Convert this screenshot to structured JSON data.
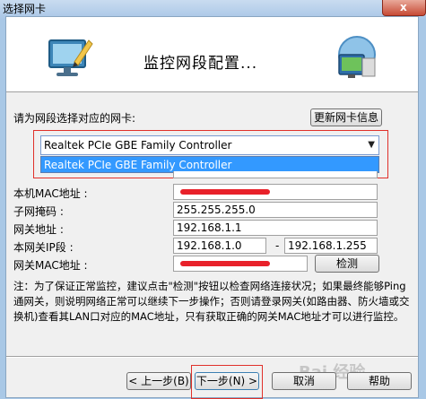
{
  "window": {
    "title": "选择网卡",
    "close_label": "x"
  },
  "header": {
    "title": "监控网段配置..."
  },
  "adapter": {
    "prompt": "请为网段选择对应的网卡:",
    "refresh_button": "更新网卡信息",
    "selected": "Realtek PCIe GBE Family Controller",
    "options": [
      "Realtek PCIe GBE Family Controller"
    ]
  },
  "form": {
    "local_mac_label": "本机MAC地址 :",
    "subnet_label": "子网掩码 :",
    "subnet_value": "255.255.255.0",
    "gateway_label": "网关地址 :",
    "gateway_value": "192.168.1.1",
    "segment_label": "本网关IP段 :",
    "segment_start": "192.168.1.0",
    "segment_dash": "-",
    "segment_end": "192.168.1.255",
    "gateway_mac_label": "网关MAC地址 :",
    "detect_button": "检测"
  },
  "note": {
    "text": "注：为了保证正常监控，建议点击\"检测\"按钮以检查网络连接状况；如果最终能够Ping通网关，则说明网络正常可以继续下一步操作；否则请登录网关(如路由器、防火墙或交换机)查看其LAN口对应的MAC地址，只有获取正确的网关MAC地址才可以进行监控。"
  },
  "footer": {
    "prev_button": "< 上一步(B)",
    "next_button": "下一步(N) >",
    "cancel_button": "取消",
    "help_button": "帮助"
  },
  "colors": {
    "highlight": "#3399ff",
    "annotation_red": "#e0302a"
  }
}
